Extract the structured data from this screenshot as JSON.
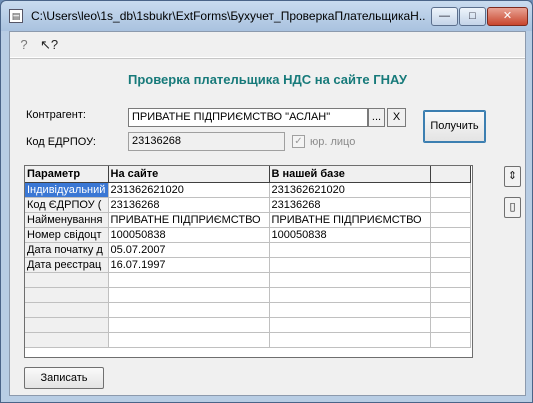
{
  "window": {
    "title": "C:\\Users\\leo\\1s_db\\1sbukr\\ExtForms\\Бухучет_ПроверкаПлательщикаН...",
    "min_label": "—",
    "max_label": "□",
    "close_label": "✕"
  },
  "toolbar": {
    "help_icon": "?",
    "whatsthis_icon": "↖?"
  },
  "form": {
    "title": "Проверка плательщика НДС на сайте ГНАУ",
    "counterparty_label": "Контрагент:",
    "counterparty_value": "ПРИВАТНЕ ПІДПРИЄМСТВО \"АСЛАН\"",
    "select_btn": "...",
    "clear_btn": "X",
    "edrpou_label": "Код ЕДРПОУ:",
    "edrpou_value": "23136268",
    "legal_checkbox_label": "юр. лицо",
    "get_button": "Получить",
    "write_button": "Записать"
  },
  "grid": {
    "columns": [
      "Параметр",
      "На сайте",
      "В нашей базе",
      ""
    ],
    "rows": [
      [
        "Індивідуальний",
        "231362621020",
        "231362621020"
      ],
      [
        "Код ЄДРПОУ (",
        "23136268",
        "23136268"
      ],
      [
        "Найменування",
        "ПРИВАТНЕ ПІДПРИЄМСТВО",
        "ПРИВАТНЕ ПІДПРИЄМСТВО"
      ],
      [
        "Номер свідоцт",
        "100050838",
        "100050838"
      ],
      [
        "Дата початку д",
        "05.07.2007",
        ""
      ],
      [
        "Дата реєстрац",
        "16.07.1997",
        ""
      ],
      [
        "",
        "",
        ""
      ],
      [
        "",
        "",
        ""
      ],
      [
        "",
        "",
        ""
      ],
      [
        "",
        "",
        ""
      ],
      [
        "",
        "",
        ""
      ]
    ]
  },
  "side_buttons": [
    "⇕",
    "▯"
  ]
}
